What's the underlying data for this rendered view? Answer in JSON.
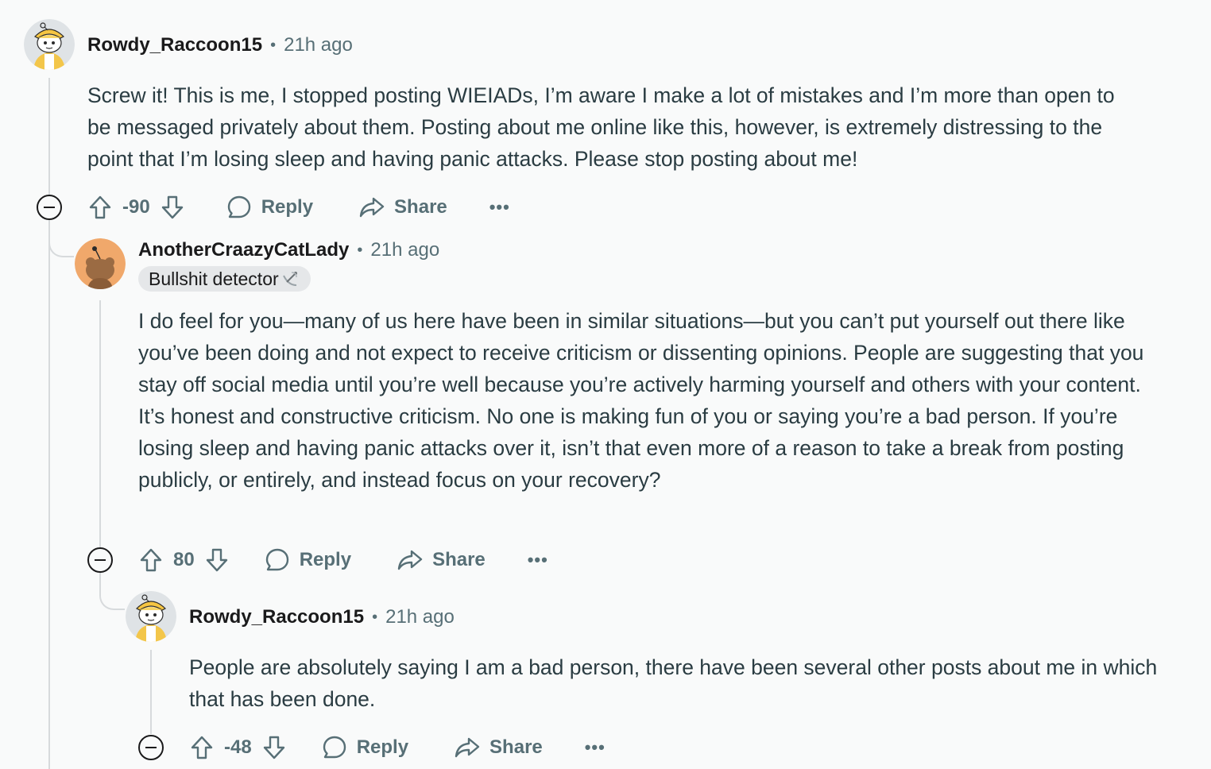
{
  "comments": [
    {
      "username": "Rowdy_Raccoon15",
      "separator": "•",
      "time": "21h ago",
      "body": "Screw it! This is me, I stopped posting WIEIADs, I’m aware I make a lot of mistakes and I’m more than open to be messaged privately about them. Posting about me online like this, however, is extremely distressing to the point that I’m losing sleep and having panic attacks. Please stop posting about me!",
      "score": "-90",
      "reply_label": "Reply",
      "share_label": "Share",
      "more_label": "•••"
    },
    {
      "username": "AnotherCraazyCatLady",
      "separator": "•",
      "time": "21h ago",
      "flair": "Bullshit detector",
      "body": "I do feel for you—many of us here have been in similar situations—but you can’t put yourself out there like you’ve been doing and not expect to receive criticism or dissenting opinions. People are suggesting that you stay off social media until you’re well because you’re actively harming yourself and others with your content. It’s honest and constructive criticism. No one is making fun of you or saying you’re a bad person. If you’re losing sleep and having panic attacks over it, isn’t that even more of a reason to take a break from posting publicly, or entirely, and instead focus on your recovery?",
      "score": "80",
      "reply_label": "Reply",
      "share_label": "Share",
      "more_label": "•••"
    },
    {
      "username": "Rowdy_Raccoon15",
      "separator": "•",
      "time": "21h ago",
      "body": "People are absolutely saying I am a bad person, there have been several other posts about me in which that has been done.",
      "score": "-48",
      "reply_label": "Reply",
      "share_label": "Share",
      "more_label": "•••"
    }
  ],
  "colors": {
    "text_primary": "#1a1a1b",
    "text_secondary": "#576f76",
    "thread_line": "#d7dadc",
    "flair_bg": "#e5e7e9",
    "avatar_orange": "#f0a86b"
  },
  "icons": [
    "upvote-icon",
    "downvote-icon",
    "comment-icon",
    "share-icon",
    "collapse-icon",
    "satellite-icon"
  ]
}
